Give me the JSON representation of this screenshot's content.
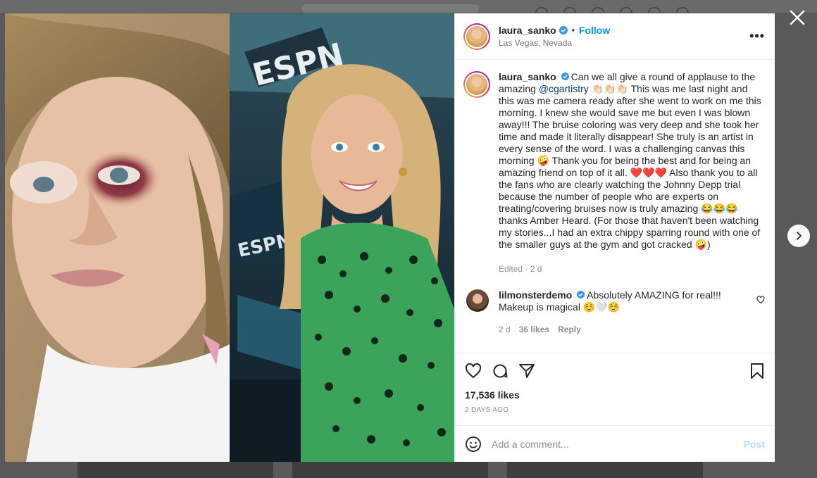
{
  "post": {
    "username": "laura_sanko",
    "follow_label": "Follow",
    "dot": "•",
    "location": "Las Vegas, Nevada",
    "more_label": "•••"
  },
  "caption": {
    "username": "laura_sanko",
    "part1": "Can we all give a round of applause to the amazing ",
    "mention": "@cgartistry",
    "part2": " 👏🏻👏🏻👏🏻 This was me last night and this was me camera ready after she went to work on me this morning. I knew she would save me but even I was blown away!!! The bruise coloring was very deep and she took her time and made it literally disappear! She truly is an artist in every sense of the word. I was a challenging canvas this morning 🤪 Thank you for being the best and for being an amazing friend on top of it all. ❤️❤️❤️ Also thank you to all the fans who are clearly watching the Johnny Depp trial because the number of people who are experts on treating/covering bruises now is truly amazing 😂😂😂 thanks Amber Heard. (For those that haven't been watching my stories...I had an extra chippy sparring round with one of the smaller guys at the gym and got cracked 🤪)",
    "edited_label": "Edited · 2 d"
  },
  "comment": {
    "username": "lilmonsterdemo",
    "text": "Absolutely AMAZING for real!!! Makeup is magical ☺️🤍☺️",
    "age": "2 d",
    "likes": "36 likes",
    "reply_label": "Reply"
  },
  "stats": {
    "likes": "17,536 likes",
    "time_ago": "2 DAYS AGO"
  },
  "composer": {
    "placeholder": "Add a comment...",
    "post_label": "Post"
  },
  "colors": {
    "accent": "#0095f6",
    "mention": "#00376b",
    "verified": "#3897f0",
    "post_disabled": "#b2dffc"
  },
  "icons": [
    "close-icon",
    "chevron-right-icon",
    "verified-icon",
    "more-icon",
    "heart-icon",
    "comment-icon",
    "share-icon",
    "bookmark-icon",
    "emoji-icon"
  ]
}
